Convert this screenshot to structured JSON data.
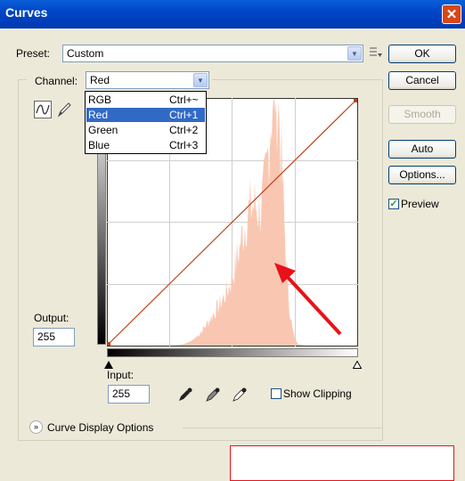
{
  "window": {
    "title": "Curves",
    "close_icon": "close-icon"
  },
  "preset": {
    "label": "Preset:",
    "value": "Custom"
  },
  "channel": {
    "label": "Channel:",
    "value": "Red",
    "menu": [
      {
        "label": "RGB",
        "shortcut": "Ctrl+~"
      },
      {
        "label": "Red",
        "shortcut": "Ctrl+1",
        "selected": true
      },
      {
        "label": "Green",
        "shortcut": "Ctrl+2"
      },
      {
        "label": "Blue",
        "shortcut": "Ctrl+3"
      }
    ]
  },
  "buttons": {
    "ok": "OK",
    "cancel": "Cancel",
    "smooth": "Smooth",
    "auto": "Auto",
    "options": "Options..."
  },
  "preview": {
    "label": "Preview",
    "checked": true
  },
  "output": {
    "label": "Output:",
    "value": "255"
  },
  "input": {
    "label": "Input:",
    "value": "255"
  },
  "show_clipping": {
    "label": "Show Clipping",
    "checked": false
  },
  "curve_display_options": {
    "label": "Curve Display Options"
  },
  "colors": {
    "histogram": "#f9c7b1",
    "curve": "#c0401a",
    "annotation_arrow": "#e8121a",
    "annotation_box": "#e8121a"
  },
  "annotation_caption": ""
}
